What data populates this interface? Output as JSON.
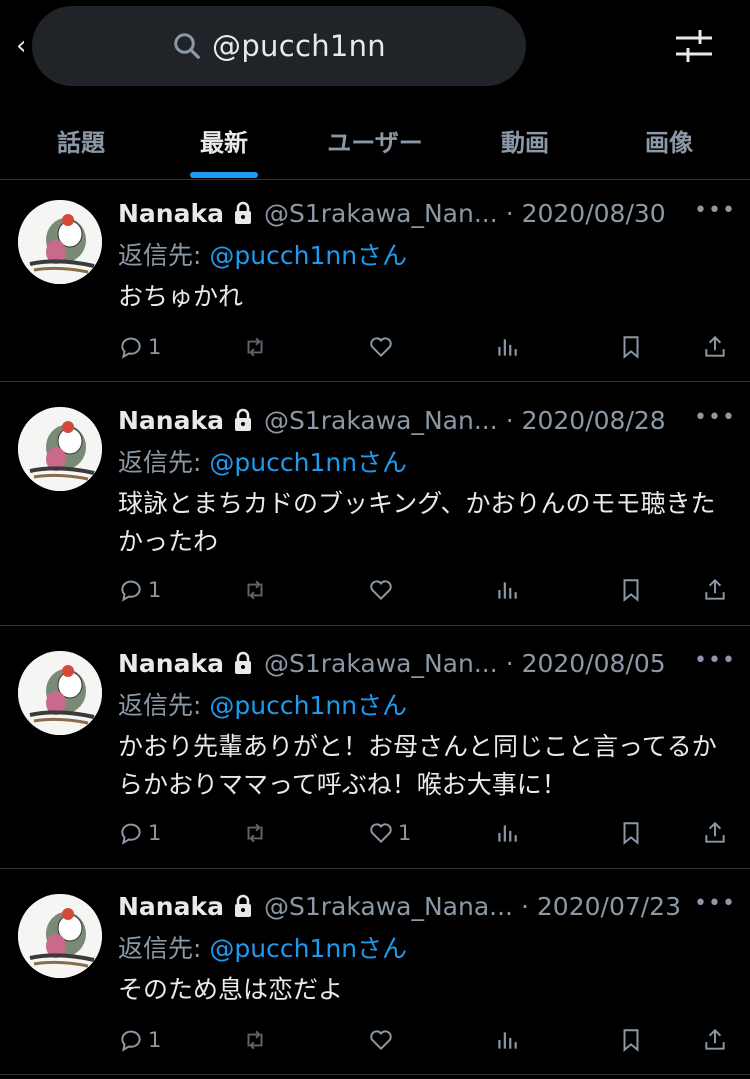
{
  "search": {
    "query": "@pucch1nn"
  },
  "tabs": [
    {
      "label": "話題"
    },
    {
      "label": "最新"
    },
    {
      "label": "ユーザー"
    },
    {
      "label": "動画"
    },
    {
      "label": "画像"
    }
  ],
  "active_tab": "最新",
  "colors": {
    "accent": "#1d9bf0",
    "background": "#000000",
    "muted": "#8b98a5"
  },
  "tweets": [
    {
      "name": "Nanaka",
      "handle": "@S1rakawa_Nan...",
      "date": "· 2020/08/30",
      "reply_prefix": "返信先:",
      "reply_mention": "@pucch1nn",
      "reply_suffix": "さん",
      "text": "おちゅかれ",
      "replies": "1",
      "retweets": "",
      "likes": ""
    },
    {
      "name": "Nanaka",
      "handle": "@S1rakawa_Nan...",
      "date": "· 2020/08/28",
      "reply_prefix": "返信先:",
      "reply_mention": "@pucch1nn",
      "reply_suffix": "さん",
      "text": "球詠とまちカドのブッキング、かおりんのモモ聴きたかったわ",
      "replies": "1",
      "retweets": "",
      "likes": ""
    },
    {
      "name": "Nanaka",
      "handle": "@S1rakawa_Nan...",
      "date": "· 2020/08/05",
      "reply_prefix": "返信先:",
      "reply_mention": "@pucch1nn",
      "reply_suffix": "さん",
      "text": "かおり先輩ありがと！お母さんと同じこと言ってるからかおりママって呼ぶね！喉お大事に！",
      "replies": "1",
      "retweets": "",
      "likes": "1"
    },
    {
      "name": "Nanaka",
      "handle": "@S1rakawa_Nana...",
      "date": "· 2020/07/23",
      "reply_prefix": "返信先:",
      "reply_mention": "@pucch1nn",
      "reply_suffix": "さん",
      "text": "そのため息は恋だよ",
      "replies": "1",
      "retweets": "",
      "likes": ""
    }
  ]
}
